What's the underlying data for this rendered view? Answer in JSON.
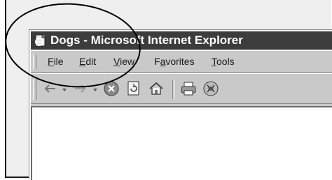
{
  "window": {
    "title": "Dogs - Microsoft Internet Explorer"
  },
  "menu": {
    "items": [
      {
        "access_key": "F",
        "rest": "ile"
      },
      {
        "access_key": "E",
        "rest": "dit"
      },
      {
        "access_key": "V",
        "rest": "iew"
      },
      {
        "lead": "F",
        "access_key": "a",
        "rest": "vorites"
      },
      {
        "access_key": "T",
        "rest": "ools"
      }
    ]
  },
  "toolbar": {
    "buttons": [
      "back-icon",
      "forward-icon",
      "stop-icon",
      "refresh-icon",
      "home-icon",
      "print-icon",
      "media-icon"
    ]
  },
  "colors": {
    "titlebar": "#3c3c3c",
    "chrome": "#c9c9c9"
  }
}
